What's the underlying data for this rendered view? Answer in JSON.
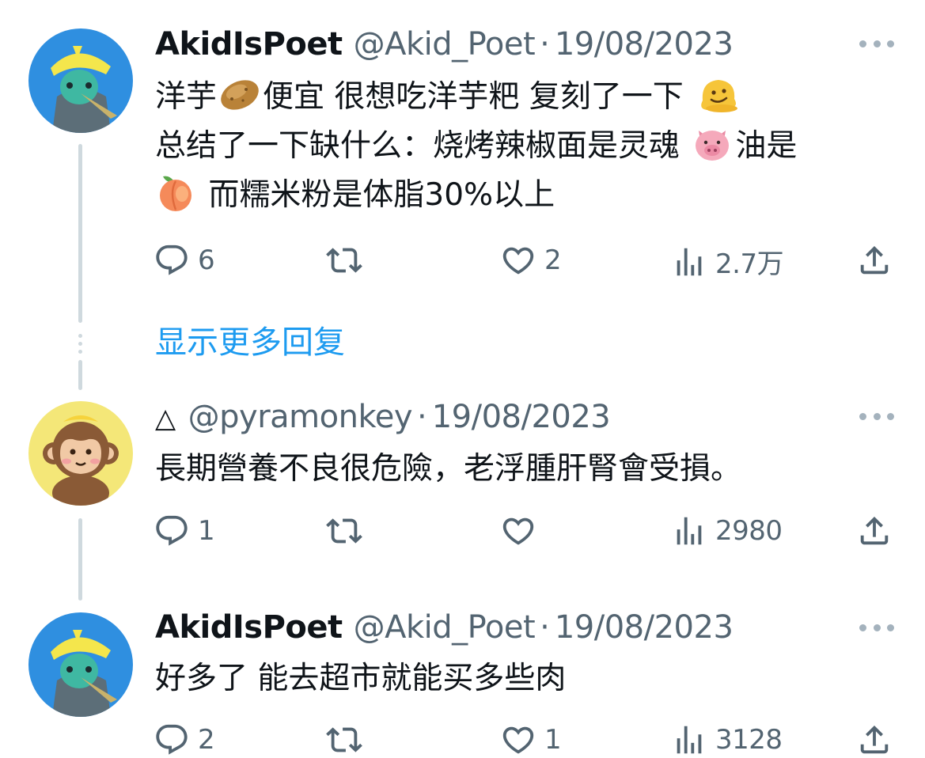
{
  "tweets": [
    {
      "name": "AkidIsPoet",
      "handle": "@Akid_Poet",
      "separator": "·",
      "date": "19/08/2023",
      "lines": [
        [
          "洋芋",
          "便宜 很想吃洋芋粑 复刻了一下"
        ],
        [
          "总结了一下缺什么：烧烤辣椒面是灵魂",
          "油是"
        ],
        [
          "",
          "而糯米粉是体脂30%以上"
        ]
      ],
      "emoji": [
        "potato",
        "melting-face",
        "pig-face",
        "peach"
      ],
      "replies": "6",
      "retweets": "",
      "likes": "2",
      "views": "2.7万"
    },
    {
      "name": "△",
      "handle": "@pyramonkey",
      "separator": "·",
      "date": "19/08/2023",
      "text": "長期營養不良很危險，老浮腫肝腎會受損。",
      "replies": "1",
      "retweets": "",
      "likes": "",
      "views": "2980"
    },
    {
      "name": "AkidIsPoet",
      "handle": "@Akid_Poet",
      "separator": "·",
      "date": "19/08/2023",
      "text": "好多了 能去超市就能买多些肉",
      "replies": "2",
      "retweets": "",
      "likes": "1",
      "views": "3128"
    }
  ],
  "show_more": "显示更多回复",
  "colors": {
    "link": "#1d9bf0",
    "muted": "#536471",
    "thread": "#cfd9de",
    "text": "#0f1419"
  }
}
